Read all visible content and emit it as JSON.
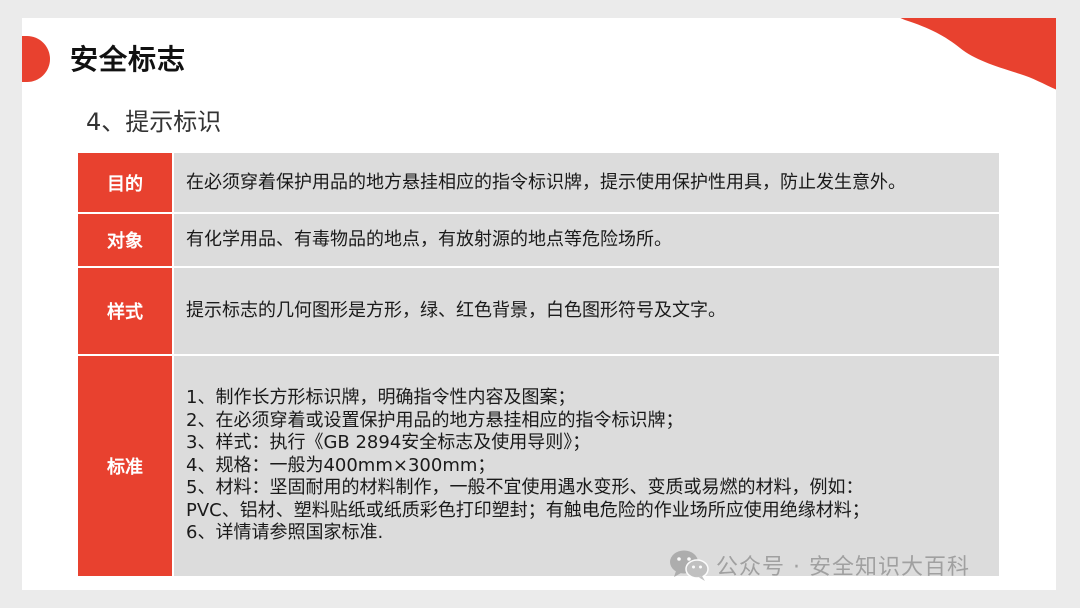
{
  "colors": {
    "accent": "#e8412f",
    "content_bg": "#dcdcdc",
    "page_bg": "#ffffff"
  },
  "header": {
    "title": "安全标志",
    "subtitle": "4、提示标识"
  },
  "table": {
    "rows": [
      {
        "label": "目的",
        "content": "在必须穿着保护用品的地方悬挂相应的指令标识牌，提示使用保护性用具，防止发生意外。"
      },
      {
        "label": "对象",
        "content": "有化学用品、有毒物品的地点，有放射源的地点等危险场所。"
      },
      {
        "label": "样式",
        "content": "提示标志的几何图形是方形，绿、红色背景，白色图形符号及文字。"
      },
      {
        "label": "标准",
        "items": [
          "1、制作长方形标识牌，明确指令性内容及图案；",
          "2、在必须穿着或设置保护用品的地方悬挂相应的指令标识牌；",
          "3、样式：执行《GB 2894安全标志及使用导则》；",
          "4、规格：一般为400mm×300mm；",
          "5、材料：坚固耐用的材料制作，一般不宜使用遇水变形、变质或易燃的材料，例如：",
          "PVC、铝材、塑料贴纸或纸质彩色打印塑封；有触电危险的作业场所应使用绝缘材料；",
          "6、详情请参照国家标准."
        ]
      }
    ]
  },
  "watermark": {
    "icon": "wechat-icon",
    "text": "公众号 · 安全知识大百科"
  }
}
